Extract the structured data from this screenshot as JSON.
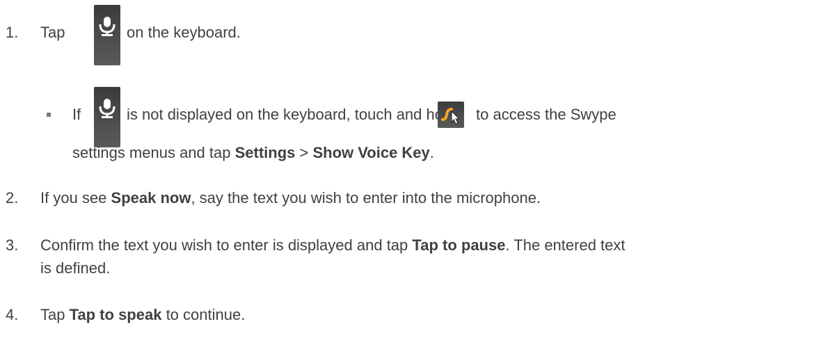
{
  "steps": [
    {
      "number": "1.",
      "before_icon": "Tap",
      "icon": "microphone-icon",
      "after_icon": "on the keyboard."
    },
    {
      "number": "2.",
      "text_before": "If you see ",
      "bold": "Speak now",
      "text_after": ", say the text you wish to enter into the microphone."
    },
    {
      "number": "3.",
      "text_before": "Confirm the text you wish to enter is displayed and tap ",
      "bold": "Tap to pause",
      "text_after": ". The entered text",
      "line2": "is defined."
    },
    {
      "number": "4.",
      "text_before": "Tap ",
      "bold": "Tap to speak",
      "text_after": " to continue."
    }
  ],
  "sub_bullet": {
    "word_if": "If",
    "mic_icon": "microphone-icon",
    "text_middle": "is not displayed on the keyboard, touch and hold",
    "swype_icon": "swype-key-icon",
    "text_end": "to access the Swype",
    "line2_before": "settings menus and tap ",
    "settings_bold": "Settings",
    "sep": " > ",
    "show_voice_bold": "Show Voice Key",
    "line2_end": "."
  },
  "colors": {
    "text": "#404040",
    "key_background": "#4a4a4a",
    "mic_glyph": "#ffffff",
    "swype_orange": "#f5a623"
  }
}
